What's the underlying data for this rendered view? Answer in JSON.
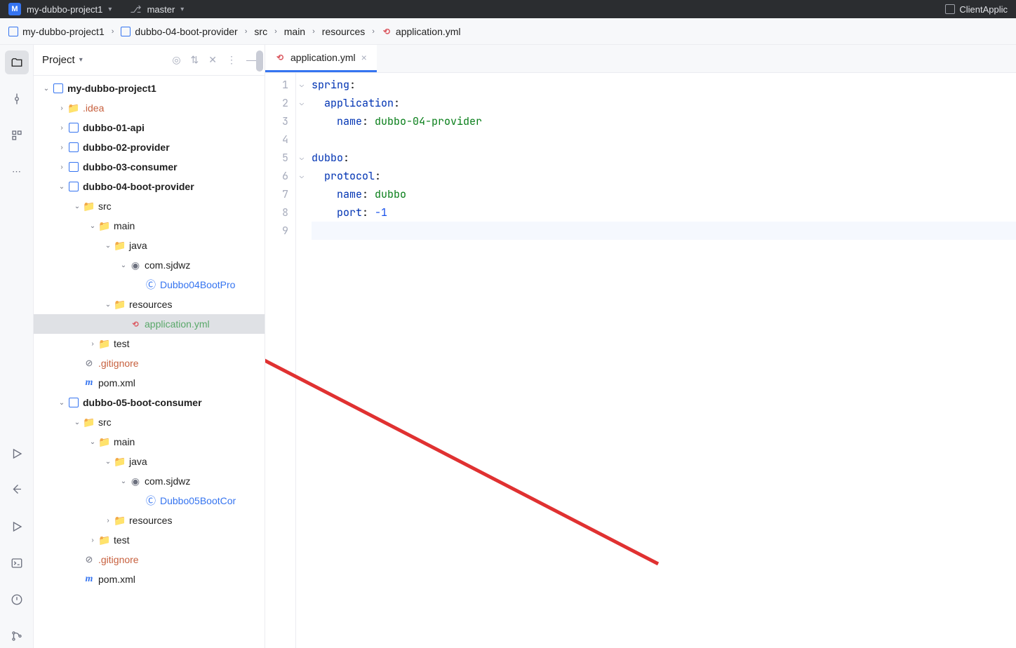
{
  "titleBar": {
    "projectName": "my-dubbo-project1",
    "branch": "master",
    "rightText": "ClientApplic"
  },
  "breadcrumbs": [
    "my-dubbo-project1",
    "dubbo-04-boot-provider",
    "src",
    "main",
    "resources",
    "application.yml"
  ],
  "projectPanel": {
    "title": "Project"
  },
  "tree": [
    {
      "depth": 0,
      "exp": "v",
      "icon": "mod",
      "label": "my-dubbo-project1",
      "bold": true
    },
    {
      "depth": 1,
      "exp": ">",
      "icon": "folder",
      "label": ".idea",
      "cls": "text-orange"
    },
    {
      "depth": 1,
      "exp": ">",
      "icon": "mod",
      "label": "dubbo-01-api",
      "bold": true
    },
    {
      "depth": 1,
      "exp": ">",
      "icon": "mod",
      "label": "dubbo-02-provider",
      "bold": true
    },
    {
      "depth": 1,
      "exp": ">",
      "icon": "mod",
      "label": "dubbo-03-consumer",
      "bold": true
    },
    {
      "depth": 1,
      "exp": "v",
      "icon": "mod",
      "label": "dubbo-04-boot-provider",
      "bold": true
    },
    {
      "depth": 2,
      "exp": "v",
      "icon": "folder",
      "label": "src"
    },
    {
      "depth": 3,
      "exp": "v",
      "icon": "folder-src",
      "label": "main"
    },
    {
      "depth": 4,
      "exp": "v",
      "icon": "folder-src",
      "label": "java"
    },
    {
      "depth": 5,
      "exp": "v",
      "icon": "pkg",
      "label": "com.sjdwz"
    },
    {
      "depth": 6,
      "exp": "",
      "icon": "java",
      "label": "Dubbo04BootPro",
      "cls": "text-blue"
    },
    {
      "depth": 4,
      "exp": "v",
      "icon": "folder-res",
      "label": "resources"
    },
    {
      "depth": 5,
      "exp": "",
      "icon": "yml",
      "label": "application.yml",
      "cls": "text-green",
      "sel": true
    },
    {
      "depth": 3,
      "exp": ">",
      "icon": "folder-test",
      "label": "test"
    },
    {
      "depth": 2,
      "exp": "",
      "icon": "gitignore",
      "label": ".gitignore",
      "cls": "text-orange"
    },
    {
      "depth": 2,
      "exp": "",
      "icon": "pom",
      "label": "pom.xml"
    },
    {
      "depth": 1,
      "exp": "v",
      "icon": "mod",
      "label": "dubbo-05-boot-consumer",
      "bold": true
    },
    {
      "depth": 2,
      "exp": "v",
      "icon": "folder",
      "label": "src"
    },
    {
      "depth": 3,
      "exp": "v",
      "icon": "folder-src",
      "label": "main"
    },
    {
      "depth": 4,
      "exp": "v",
      "icon": "folder-src",
      "label": "java"
    },
    {
      "depth": 5,
      "exp": "v",
      "icon": "pkg",
      "label": "com.sjdwz"
    },
    {
      "depth": 6,
      "exp": "",
      "icon": "java",
      "label": "Dubbo05BootCor",
      "cls": "text-blue"
    },
    {
      "depth": 4,
      "exp": ">",
      "icon": "folder-res",
      "label": "resources"
    },
    {
      "depth": 3,
      "exp": ">",
      "icon": "folder-test",
      "label": "test"
    },
    {
      "depth": 2,
      "exp": "",
      "icon": "gitignore",
      "label": ".gitignore",
      "cls": "text-orange"
    },
    {
      "depth": 2,
      "exp": "",
      "icon": "pom",
      "label": "pom.xml"
    }
  ],
  "editor": {
    "tab": "application.yml",
    "lines": 9,
    "code": [
      [
        {
          "t": "key",
          "v": "spring"
        },
        {
          "t": "plain",
          "v": ":"
        }
      ],
      [
        {
          "t": "plain",
          "v": "  "
        },
        {
          "t": "key",
          "v": "application"
        },
        {
          "t": "plain",
          "v": ":"
        }
      ],
      [
        {
          "t": "plain",
          "v": "    "
        },
        {
          "t": "key",
          "v": "name"
        },
        {
          "t": "plain",
          "v": ": "
        },
        {
          "t": "str",
          "v": "dubbo-04-provider"
        }
      ],
      [],
      [
        {
          "t": "key",
          "v": "dubbo"
        },
        {
          "t": "plain",
          "v": ":"
        }
      ],
      [
        {
          "t": "plain",
          "v": "  "
        },
        {
          "t": "key",
          "v": "protocol"
        },
        {
          "t": "plain",
          "v": ":"
        }
      ],
      [
        {
          "t": "plain",
          "v": "    "
        },
        {
          "t": "key",
          "v": "name"
        },
        {
          "t": "plain",
          "v": ": "
        },
        {
          "t": "str",
          "v": "dubbo"
        }
      ],
      [
        {
          "t": "plain",
          "v": "    "
        },
        {
          "t": "key",
          "v": "port"
        },
        {
          "t": "plain",
          "v": ": "
        },
        {
          "t": "num",
          "v": "-1"
        }
      ],
      []
    ],
    "folds": [
      true,
      true,
      false,
      false,
      true,
      true,
      false,
      false,
      false
    ]
  }
}
